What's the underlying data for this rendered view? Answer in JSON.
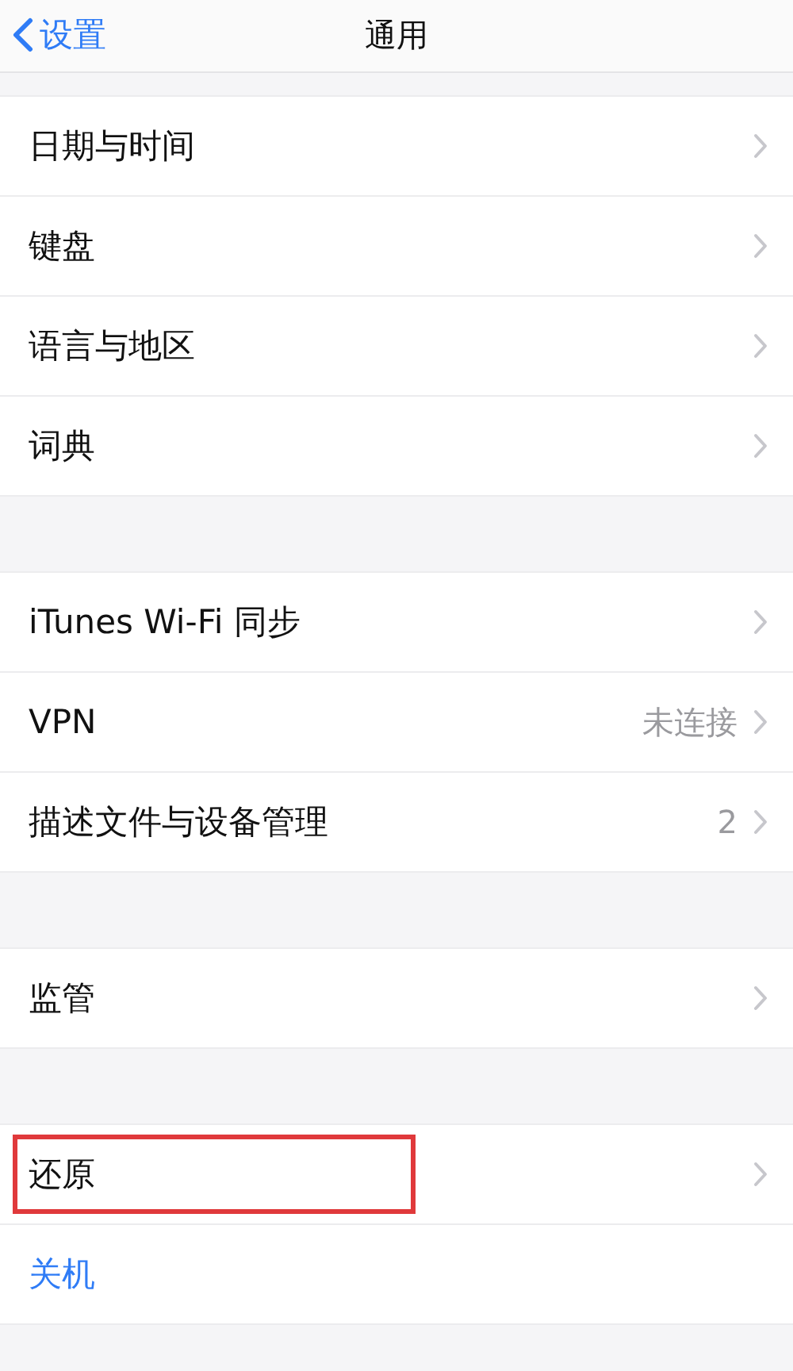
{
  "nav": {
    "back": "设置",
    "title": "通用"
  },
  "groups": [
    {
      "rows": [
        {
          "kind": "link",
          "label": "日期与时间"
        },
        {
          "kind": "link",
          "label": "键盘"
        },
        {
          "kind": "link",
          "label": "语言与地区"
        },
        {
          "kind": "link",
          "label": "词典"
        }
      ]
    },
    {
      "rows": [
        {
          "kind": "link",
          "label": "iTunes Wi-Fi 同步"
        },
        {
          "kind": "link",
          "label": "VPN",
          "value": "未连接"
        },
        {
          "kind": "link",
          "label": "描述文件与设备管理",
          "value": "2"
        }
      ]
    },
    {
      "rows": [
        {
          "kind": "link",
          "label": "监管"
        }
      ]
    },
    {
      "rows": [
        {
          "kind": "link",
          "label": "还原",
          "highlighted": true
        },
        {
          "kind": "action",
          "label": "关机",
          "highlighted": false
        }
      ]
    }
  ]
}
